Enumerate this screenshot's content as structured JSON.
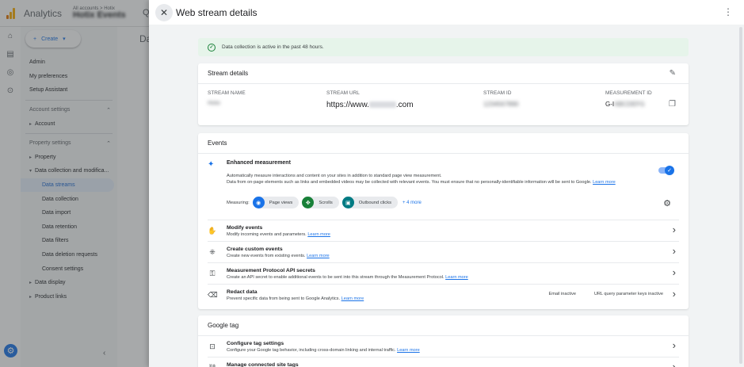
{
  "app": {
    "title": "Analytics",
    "account_path": "All accounts > Hotix",
    "account_name": "Hotix Events"
  },
  "nav": {
    "create_label": "Create",
    "items": [
      {
        "label": "Admin",
        "kind": "top"
      },
      {
        "label": "My preferences",
        "kind": "top"
      },
      {
        "label": "Setup Assistant",
        "kind": "top"
      },
      {
        "label": "Account settings",
        "kind": "head"
      },
      {
        "label": "Account",
        "kind": "expand"
      },
      {
        "label": "Property settings",
        "kind": "head"
      },
      {
        "label": "Property",
        "kind": "expand"
      },
      {
        "label": "Data collection and modifica...",
        "kind": "expanded"
      },
      {
        "label": "Data streams",
        "kind": "sub",
        "active": true
      },
      {
        "label": "Data collection",
        "kind": "sub"
      },
      {
        "label": "Data import",
        "kind": "sub"
      },
      {
        "label": "Data retention",
        "kind": "sub"
      },
      {
        "label": "Data filters",
        "kind": "sub"
      },
      {
        "label": "Data deletion requests",
        "kind": "sub"
      },
      {
        "label": "Consent settings",
        "kind": "sub"
      },
      {
        "label": "Data display",
        "kind": "expand"
      },
      {
        "label": "Product links",
        "kind": "expand"
      }
    ]
  },
  "background_page_title": "Da",
  "drawer": {
    "title": "Web stream details",
    "alert": "Data collection is active in the past 48 hours.",
    "stream_details": {
      "heading": "Stream details",
      "stream_name_label": "STREAM NAME",
      "stream_name_value": "Hotix",
      "stream_url_label": "STREAM URL",
      "stream_url_prefix": "https://www.",
      "stream_url_suffix": ".com",
      "stream_id_label": "STREAM ID",
      "stream_id_value": "1234567890",
      "measurement_id_label": "MEASUREMENT ID",
      "measurement_id_prefix": "G-I",
      "measurement_id_rest": "ABCDEFG"
    },
    "events": {
      "heading": "Events",
      "enhanced": {
        "title": "Enhanced measurement",
        "desc1": "Automatically measure interactions and content on your sites in addition to standard page view measurement.",
        "desc2": "Data from on-page elements such as links and embedded videos may be collected with relevant events. You must ensure that no personally-identifiable information will be sent to Google.",
        "learn_more": "Learn more",
        "measuring_label": "Measuring:",
        "chips": [
          {
            "label": "Page views",
            "color": "#1a73e8",
            "icon": "eye-icon"
          },
          {
            "label": "Scrolls",
            "color": "#188038",
            "icon": "crosshair-icon"
          },
          {
            "label": "Outbound clicks",
            "color": "#007b83",
            "icon": "mouse-icon"
          }
        ],
        "more": "+ 4 more"
      },
      "rows": [
        {
          "title": "Modify events",
          "desc": "Modify incoming events and parameters.",
          "link": "Learn more",
          "icon": "hand-icon"
        },
        {
          "title": "Create custom events",
          "desc": "Create new events from existing events.",
          "link": "Learn more",
          "icon": "sparkle-cursor-icon"
        },
        {
          "title": "Measurement Protocol API secrets",
          "desc": "Create an API secret to enable additional events to be sent into this stream through the Measurement Protocol.",
          "link": "Learn more",
          "icon": "key-icon"
        },
        {
          "title": "Redact data",
          "desc": "Prevent specific data from being sent to Google Analytics.",
          "link": "Learn more",
          "icon": "eraser-icon",
          "status1": "Email inactive",
          "status2": "URL query parameter keys inactive"
        }
      ]
    },
    "google_tag": {
      "heading": "Google tag",
      "rows": [
        {
          "title": "Configure tag settings",
          "desc": "Configure your Google tag behavior, including cross-domain linking and internal traffic.",
          "link": "Learn more",
          "icon": "tag-icon"
        },
        {
          "title": "Manage connected site tags",
          "desc": "",
          "link": "",
          "icon": "link-icon"
        }
      ]
    }
  }
}
